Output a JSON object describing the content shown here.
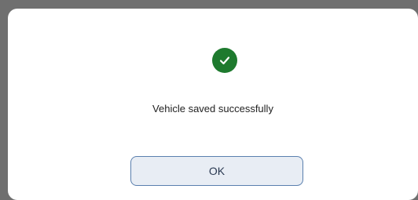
{
  "dialog": {
    "icon": "check-circle-icon",
    "icon_color": "#1e7a2e",
    "message": "Vehicle saved successfully",
    "ok_label": "OK"
  }
}
